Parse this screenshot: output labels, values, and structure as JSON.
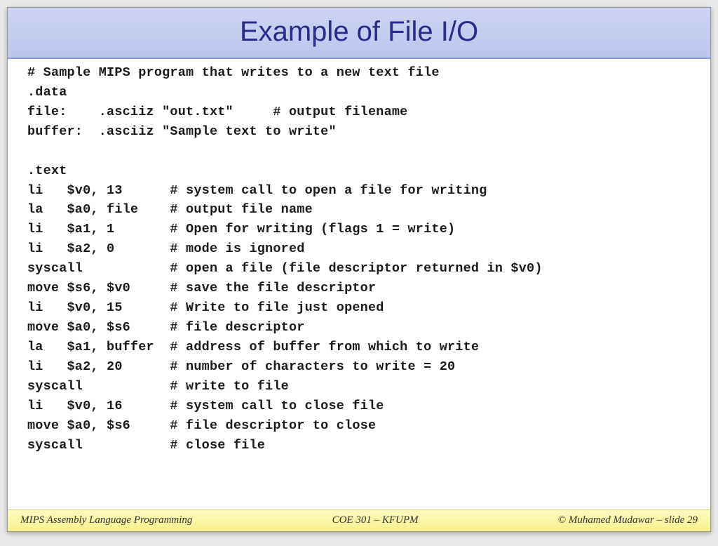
{
  "title": "Example of File I/O",
  "code_lines": [
    "# Sample MIPS program that writes to a new text file",
    ".data",
    "file:    .asciiz \"out.txt\"     # output filename",
    "buffer:  .asciiz \"Sample text to write\"",
    "",
    ".text",
    "li   $v0, 13      # system call to open a file for writing",
    "la   $a0, file    # output file name",
    "li   $a1, 1       # Open for writing (flags 1 = write)",
    "li   $a2, 0       # mode is ignored",
    "syscall           # open a file (file descriptor returned in $v0)",
    "move $s6, $v0     # save the file descriptor",
    "li   $v0, 15      # Write to file just opened",
    "move $a0, $s6     # file descriptor",
    "la   $a1, buffer  # address of buffer from which to write",
    "li   $a2, 20      # number of characters to write = 20",
    "syscall           # write to file",
    "li   $v0, 16      # system call to close file",
    "move $a0, $s6     # file descriptor to close",
    "syscall           # close file"
  ],
  "footer": {
    "left": "MIPS Assembly Language Programming",
    "center": "COE 301 – KFUPM",
    "right": "© Muhamed Mudawar – slide 29"
  }
}
